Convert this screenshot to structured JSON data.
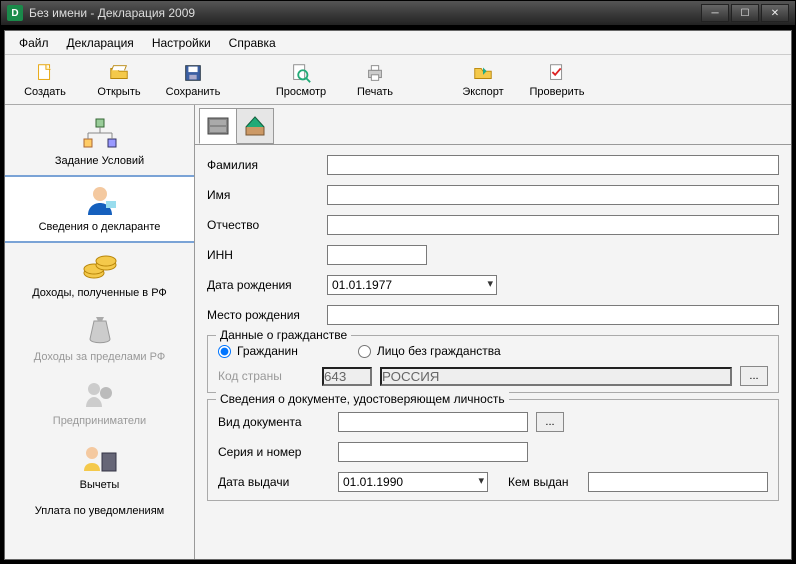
{
  "window": {
    "title": "Без имени - Декларация 2009"
  },
  "menu": {
    "file": "Файл",
    "decl": "Декларация",
    "settings": "Настройки",
    "help": "Справка"
  },
  "toolbar": {
    "create": "Создать",
    "open": "Открыть",
    "save": "Сохранить",
    "preview": "Просмотр",
    "print": "Печать",
    "export": "Экспорт",
    "check": "Проверить"
  },
  "sidebar": {
    "conditions": "Задание Условий",
    "declarant": "Сведения о декларанте",
    "income_rf": "Доходы, полученные в РФ",
    "income_abroad": "Доходы за пределами РФ",
    "entrepreneurs": "Предприниматели",
    "deductions": "Вычеты",
    "notifications": "Уплата по уведомлениям"
  },
  "form": {
    "surname": "Фамилия",
    "name": "Имя",
    "patronymic": "Отчество",
    "inn": "ИНН",
    "dob": "Дата рождения",
    "dob_val": "01.01.1977",
    "pob": "Место рождения",
    "citizenship": {
      "title": "Данные о гражданстве",
      "citizen": "Гражданин",
      "stateless": "Лицо без гражданства",
      "country_code_lbl": "Код страны",
      "country_code": "643",
      "country_name": "РОССИЯ"
    },
    "idoc": {
      "title": "Сведения о документе, удостоверяющем личность",
      "type": "Вид документа",
      "series": "Серия и номер",
      "issue_date_lbl": "Дата выдачи",
      "issue_date": "01.01.1990",
      "issuer": "Кем выдан"
    }
  }
}
